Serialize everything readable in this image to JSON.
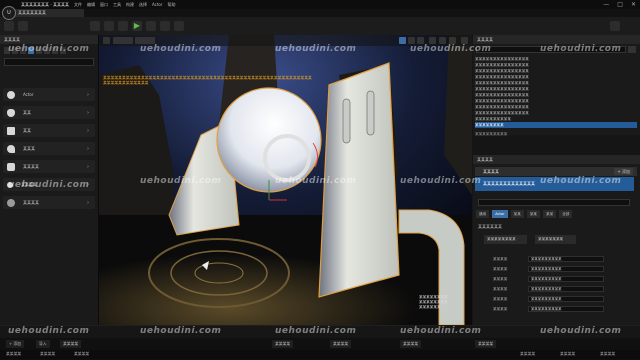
{
  "app": {
    "logo_text": "U",
    "title": "某某某某某某某 - 某某某某",
    "menu": [
      "文件",
      "编辑",
      "窗口",
      "工具",
      "构建",
      "选择",
      "Actor",
      "帮助"
    ],
    "window_controls": [
      "—",
      "□",
      "✕"
    ]
  },
  "doc_tab": {
    "label": "某某某某某某某"
  },
  "left_panel": {
    "title": "某某某某",
    "items": [
      {
        "label": "Actor",
        "icon": "sphere-icon"
      },
      {
        "label": "某某",
        "icon": "light-bulb-icon"
      },
      {
        "label": "某某",
        "icon": "camera-icon"
      },
      {
        "label": "某某某",
        "icon": "shape-icon"
      },
      {
        "label": "某某某某",
        "icon": "volume-icon"
      },
      {
        "label": "某某某某",
        "icon": "visual-effects-icon"
      },
      {
        "label": "某某某某",
        "icon": "all-classes-icon"
      }
    ],
    "chevron": "›"
  },
  "viewport": {
    "annotation": "某某某某某某某某某某某某某某某某某某某某某某某某某某某某某某某某某某某某某某某某某某某某某某某某某某某某某某某某某某某某某某某某某某某",
    "stats_lines": [
      "某某某某某某某某",
      "某某某某某某某某",
      "某某某某某某"
    ]
  },
  "outliner": {
    "title": "某某某某",
    "rows": [
      {
        "label": "某某某某某某某某某某某某某某某",
        "selected": false
      },
      {
        "label": "某某某某某某某某某某某某某某某",
        "selected": false
      },
      {
        "label": "某某某某某某某某某某某某某某某",
        "selected": false
      },
      {
        "label": "某某某某某某某某某某某某某某某",
        "selected": false
      },
      {
        "label": "某某某某某某某某某某某某某某某",
        "selected": false
      },
      {
        "label": "某某某某某某某某某某某某某某某",
        "selected": false
      },
      {
        "label": "某某某某某某某某某某某某某某某",
        "selected": false
      },
      {
        "label": "某某某某某某某某某某某某某某某",
        "selected": false
      },
      {
        "label": "某某某某某某某某某某某某某某某",
        "selected": false
      },
      {
        "label": "某某某某某某某某某某某某某某某",
        "selected": false
      },
      {
        "label": "某某某某某某某某",
        "selected": true
      },
      {
        "label": "某某某某某某某某某某",
        "selected": false
      }
    ],
    "count": "某某某某某某某某某"
  },
  "details": {
    "title": "某某某某",
    "actor_label": "某某某某",
    "add_button": "+ 添加",
    "component_label": "某某某某某某某某某某某某某",
    "tabs": [
      "通用",
      "Actor",
      "某某",
      "某某",
      "某某",
      "全部"
    ],
    "section_label": "某某某某某某",
    "asset_a": "某某某某某某某某",
    "asset_b": "某某某某某某某",
    "props": [
      {
        "label": "某某某某",
        "value": "某某某某某某某某某"
      },
      {
        "label": "某某某某",
        "value": "某某某某某某某某某"
      },
      {
        "label": "某某某某",
        "value": "某某某某某某某某某"
      },
      {
        "label": "某某某某",
        "value": "某某某某某某某某某"
      },
      {
        "label": "某某某某",
        "value": "某某某某某某某某某"
      },
      {
        "label": "某某某某",
        "value": "某某某某某某某某某"
      }
    ]
  },
  "bottom": {
    "buttons": [
      "+ 添加",
      "导入",
      "某某某某",
      "某某某某",
      "某某某某",
      "某某某某",
      "某某某某"
    ],
    "status": [
      "某某某某",
      "某某某某",
      "某某某某",
      "某某某某",
      "某某某某",
      "某某某某"
    ]
  },
  "watermark": "uehoudini.com"
}
